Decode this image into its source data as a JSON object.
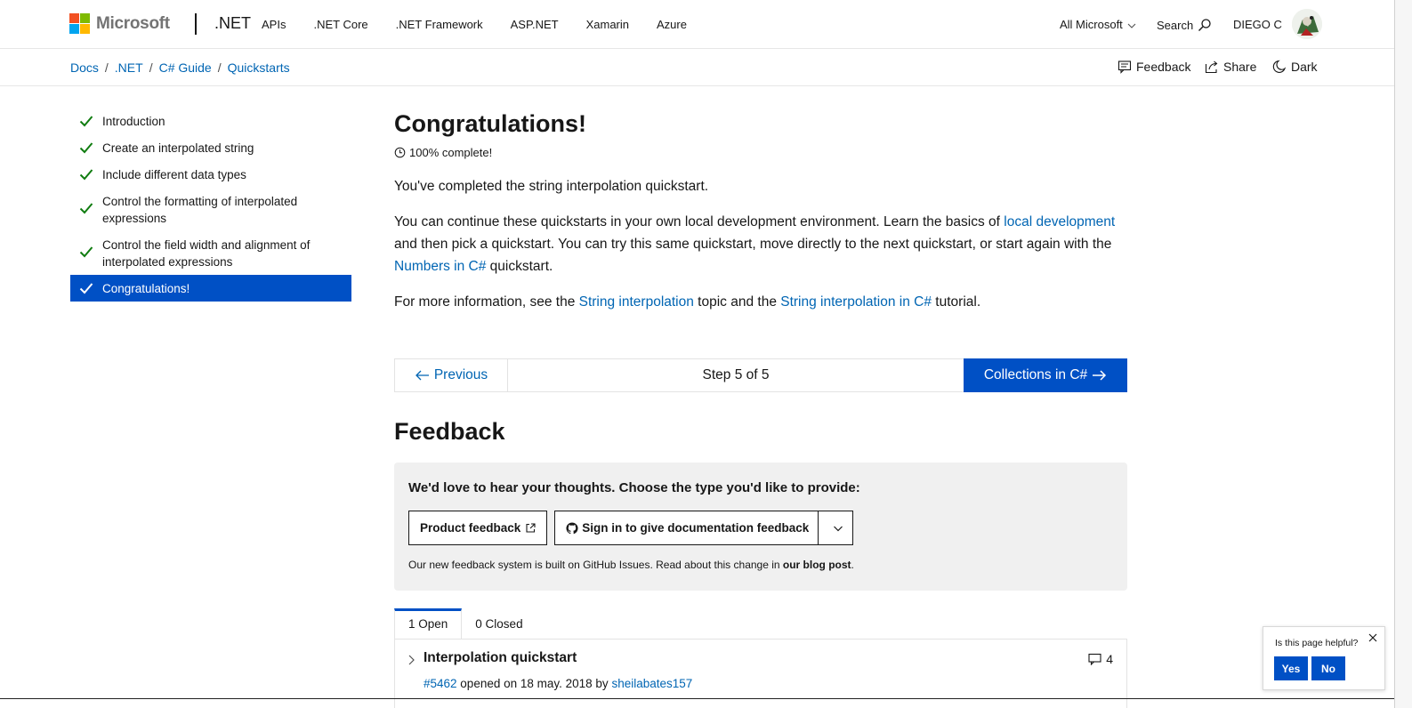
{
  "header": {
    "brand_word": "Microsoft",
    "product": ".NET",
    "nav": [
      "APIs",
      ".NET Core",
      ".NET Framework",
      "ASP.NET",
      "Xamarin",
      "Azure"
    ],
    "all_microsoft": "All Microsoft",
    "search": "Search",
    "user_name": "DIEGO C",
    "logo_colors": [
      "#f25022",
      "#7fba00",
      "#00a4ef",
      "#ffb900"
    ]
  },
  "subheader": {
    "breadcrumbs": [
      "Docs",
      ".NET",
      "C# Guide",
      "Quickstarts"
    ],
    "separator": "/",
    "feedback": "Feedback",
    "share": "Share",
    "dark": "Dark"
  },
  "toc": {
    "items": [
      {
        "label": "Introduction"
      },
      {
        "label": "Create an interpolated string"
      },
      {
        "label": "Include different data types"
      },
      {
        "label": "Control the formatting of interpolated expressions"
      },
      {
        "label": "Control the field width and alignment of interpolated expressions"
      },
      {
        "label": "Congratulations!"
      }
    ],
    "active_index": 5,
    "check_color": "#107c10",
    "active_color": "#0050c5"
  },
  "main": {
    "title": "Congratulations!",
    "progress": "100% complete!",
    "p1": "You've completed the string interpolation quickstart.",
    "p2_a": "You can continue these quickstarts in your own local development environment. Learn the basics of ",
    "p2_link1": "local development",
    "p2_b": " and then pick a quickstart. You can try this same quickstart, move directly to the next quickstart, or start again with the ",
    "p2_link2": "Numbers in C#",
    "p2_c": " quickstart.",
    "p3_a": "For more information, see the ",
    "p3_link1": "String interpolation",
    "p3_b": " topic and the ",
    "p3_link2": "String interpolation in C#",
    "p3_c": " tutorial.",
    "previous": "Previous",
    "step": "Step 5 of 5",
    "next": "Collections in C#"
  },
  "feedback": {
    "title": "Feedback",
    "prompt": "We'd love to hear your thoughts. Choose the type you'd like to provide:",
    "product_btn": "Product feedback",
    "docs_btn": "Sign in to give documentation feedback",
    "note_a": "Our new feedback system is built on GitHub Issues. Read about this change in ",
    "note_link": "our blog post",
    "note_b": "."
  },
  "issues": {
    "tab_open": "1 Open",
    "tab_closed": "0 Closed",
    "items": [
      {
        "title": "Interpolation quickstart",
        "number": "#5462",
        "opened_text": " opened on 18 may. 2018 by ",
        "author": "sheilabates157",
        "comments": "4"
      }
    ]
  },
  "helpful": {
    "question": "Is this page helpful?",
    "yes": "Yes",
    "no": "No"
  }
}
